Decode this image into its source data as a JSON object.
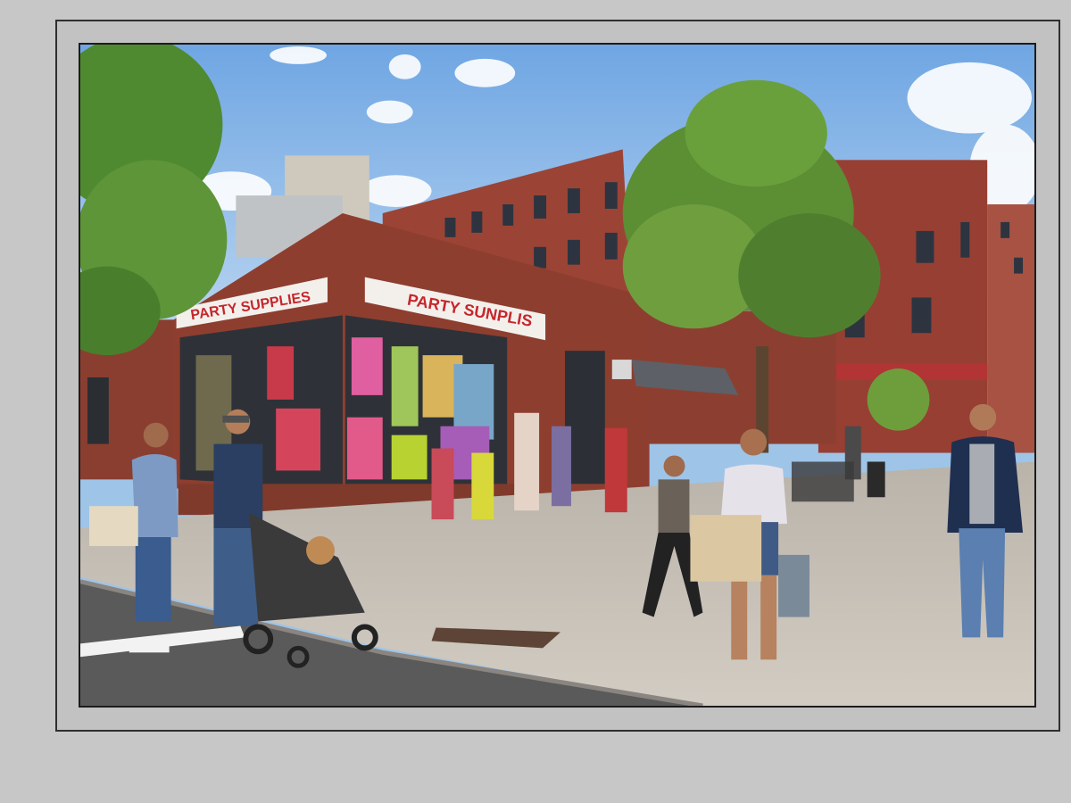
{
  "image": {
    "subject": "street-corner-storefront",
    "signs": {
      "left": "PARTY SUPPLIES",
      "right": "PARTY SUNPLIS"
    },
    "colors": {
      "background": "#c7c7c7",
      "mat": "#c2c2c2",
      "frame_border": "#2f2f2f",
      "sky": "#9ec4e8",
      "brick": "#8f3f2f",
      "sign_bg": "#f3f0ec",
      "sign_text": "#c6262b",
      "tree": "#5f8f33",
      "sidewalk": "#c7c2ba",
      "road": "#5a5a5a"
    }
  }
}
